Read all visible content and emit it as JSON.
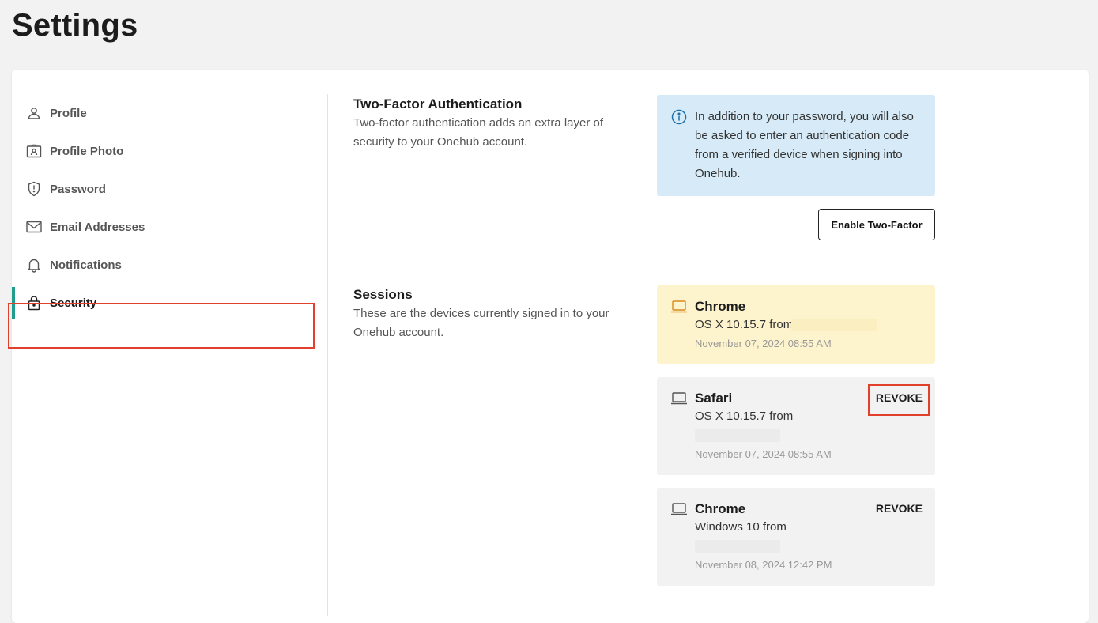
{
  "page": {
    "title": "Settings"
  },
  "sidebar": {
    "items": [
      {
        "label": "Profile",
        "icon": "person-icon"
      },
      {
        "label": "Profile Photo",
        "icon": "id-badge-icon"
      },
      {
        "label": "Password",
        "icon": "shield-icon"
      },
      {
        "label": "Email Addresses",
        "icon": "envelope-icon"
      },
      {
        "label": "Notifications",
        "icon": "bell-icon"
      },
      {
        "label": "Security",
        "icon": "lock-icon",
        "active": true
      }
    ],
    "accent_color": "#1f9e8e"
  },
  "two_factor": {
    "title": "Two-Factor Authentication",
    "description": "Two-factor authentication adds an extra layer of security to your Onehub account.",
    "info": "In addition to your password, you will also be asked to enter an authentication code from a verified device when signing into Onehub.",
    "button_label": "Enable Two-Factor"
  },
  "sessions": {
    "title": "Sessions",
    "description": "These are the devices currently signed in to your Onehub account.",
    "items": [
      {
        "browser": "Chrome",
        "os": "OS X 10.15.7 from",
        "date": "November 07, 2024 08:55 AM",
        "current": true
      },
      {
        "browser": "Safari",
        "os": "OS X 10.15.7 from",
        "date": "November 07, 2024 08:55 AM",
        "revoke_label": "REVOKE"
      },
      {
        "browser": "Chrome",
        "os": "Windows 10 from",
        "date": "November 08, 2024 12:42 PM",
        "revoke_label": "REVOKE"
      }
    ]
  }
}
